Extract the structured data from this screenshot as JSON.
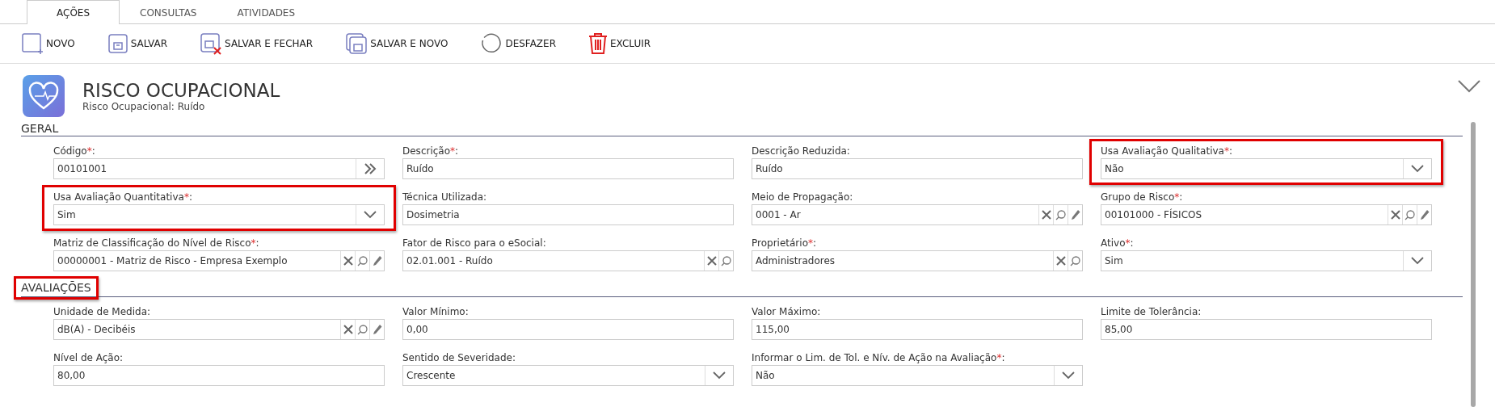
{
  "tabs": [
    {
      "label": "AÇÕES",
      "selected": true
    },
    {
      "label": "CONSULTAS",
      "selected": false
    },
    {
      "label": "ATIVIDADES",
      "selected": false
    }
  ],
  "toolbar": [
    {
      "kind": "new",
      "label": "NOVO"
    },
    {
      "kind": "save",
      "label": "SALVAR"
    },
    {
      "kind": "save_close",
      "label": "SALVAR E FECHAR"
    },
    {
      "kind": "save_new",
      "label": "SALVAR E NOVO"
    },
    {
      "kind": "undo",
      "label": "DESFAZER"
    },
    {
      "kind": "delete",
      "label": "EXCLUIR"
    }
  ],
  "header": {
    "title": "RISCO OCUPACIONAL",
    "subtitle": "Risco Ocupacional: Ruído",
    "expanded": true
  },
  "sections": [
    {
      "title": "GERAL",
      "highlighted": false,
      "fields": [
        {
          "label": "Código",
          "asterisk": "*",
          "colon": ":",
          "kind": "code",
          "value": "00101001",
          "highlighted": false
        },
        {
          "label": "Descrição",
          "asterisk": "*",
          "colon": ":",
          "kind": "text",
          "value": "Ruído",
          "highlighted": false
        },
        {
          "label": "Descrição Reduzida",
          "colon": ":",
          "kind": "text",
          "value": "Ruído",
          "highlighted": false
        },
        {
          "label": "Usa Avaliação Qualitativa",
          "asterisk": "*",
          "colon": ":",
          "kind": "select",
          "value": "Não",
          "highlighted": true
        },
        {
          "label": "Usa Avaliação Quantitativa",
          "asterisk": "*",
          "colon": ":",
          "kind": "select",
          "value": "Sim",
          "highlighted": true
        },
        {
          "label": "Técnica Utilizada",
          "colon": ":",
          "kind": "text",
          "value": "Dosimetria",
          "highlighted": false
        },
        {
          "label": "Meio de Propagação",
          "colon": ":",
          "kind": "lookup_edit",
          "value": "0001 - Ar",
          "highlighted": false
        },
        {
          "label": "Grupo de Risco",
          "asterisk": "*",
          "colon": ":",
          "kind": "lookup_edit",
          "value": "00101000 - FÍSICOS",
          "highlighted": false
        },
        {
          "label": "Matriz de Classificação do Nível de Risco",
          "asterisk": "*",
          "colon": ":",
          "kind": "lookup_edit",
          "value": "00000001 - Matriz de Risco - Empresa Exemplo",
          "highlighted": false
        },
        {
          "label": "Fator de Risco para o eSocial",
          "colon": ":",
          "kind": "lookup",
          "value": "02.01.001 - Ruído",
          "highlighted": false
        },
        {
          "label": "Proprietário",
          "asterisk": "*",
          "colon": ":",
          "kind": "lookup",
          "value": "Administradores",
          "highlighted": false
        },
        {
          "label": "Ativo",
          "asterisk": "*",
          "colon": ":",
          "kind": "select",
          "value": "Sim",
          "highlighted": false
        }
      ]
    },
    {
      "title": "AVALIAÇÕES",
      "highlighted": true,
      "fields": [
        {
          "label": "Unidade de Medida",
          "colon": ":",
          "kind": "lookup_edit",
          "value": "dB(A) - Decibéis",
          "highlighted": false
        },
        {
          "label": "Valor Mínimo",
          "colon": ":",
          "kind": "text",
          "value": "0,00",
          "highlighted": false
        },
        {
          "label": "Valor Máximo",
          "colon": ":",
          "kind": "text",
          "value": "115,00",
          "highlighted": false
        },
        {
          "label": "Limite de Tolerância",
          "colon": ":",
          "kind": "text",
          "value": "85,00",
          "highlighted": false
        },
        {
          "label": "Nível de Ação",
          "colon": ":",
          "kind": "text",
          "value": "80,00",
          "highlighted": false
        },
        {
          "label": "Sentido de Severidade",
          "colon": ":",
          "kind": "select",
          "value": "Crescente",
          "highlighted": false
        },
        {
          "label": "Informar o Lim. de Tol. e Nív. de Ação na Avaliação",
          "asterisk": "*",
          "colon": ":",
          "kind": "select",
          "value": "Não",
          "highlighted": false
        }
      ]
    }
  ]
}
